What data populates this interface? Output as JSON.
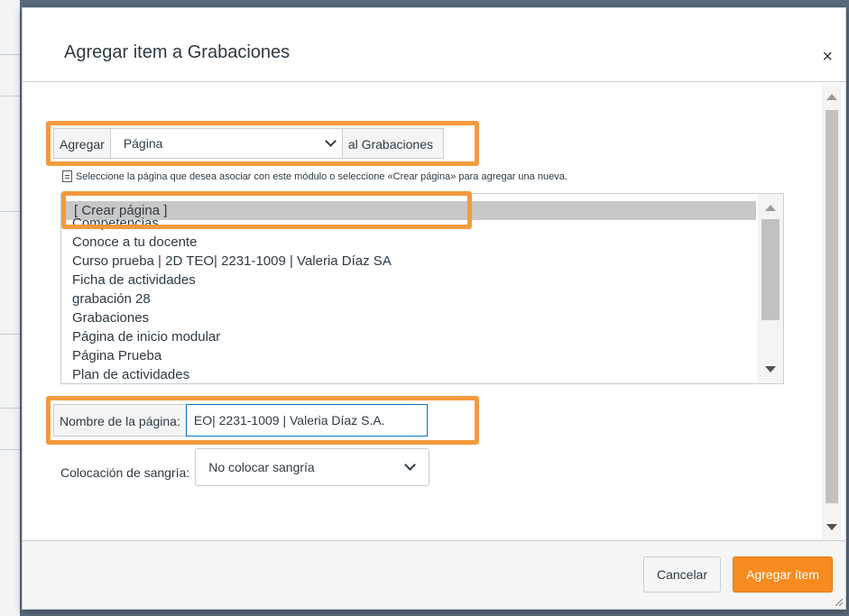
{
  "dialog": {
    "title": "Agregar item a Grabaciones",
    "close_label": "×"
  },
  "add_row": {
    "prefix": "Agregar",
    "type_selected": "Página",
    "suffix": "al Grabaciones"
  },
  "hint": "Seleccione la página que desea asociar con este módulo o seleccione «Crear página» para agregar una nueva.",
  "page_list": [
    "[ Crear página ]",
    "Competencias",
    "Conoce a tu docente",
    "Curso prueba | 2D TEO| 2231-1009 | Valeria Díaz SA",
    "Ficha de actividades",
    "grabación 28",
    "Grabaciones",
    "Página de inicio modular",
    "Página Prueba",
    "Plan de actividades"
  ],
  "name_row": {
    "label": "Nombre de la página:",
    "value": "EO| 2231-1009 | Valeria Díaz S.A."
  },
  "indent_row": {
    "label": "Colocación de sangría:",
    "selected": "No colocar sangría"
  },
  "footer": {
    "cancel_label": "Cancelar",
    "submit_label": "Agregar ítem"
  },
  "colors": {
    "highlight": "#f39a3d",
    "primary_button": "#f68b1f",
    "text": "#2d3b45"
  }
}
